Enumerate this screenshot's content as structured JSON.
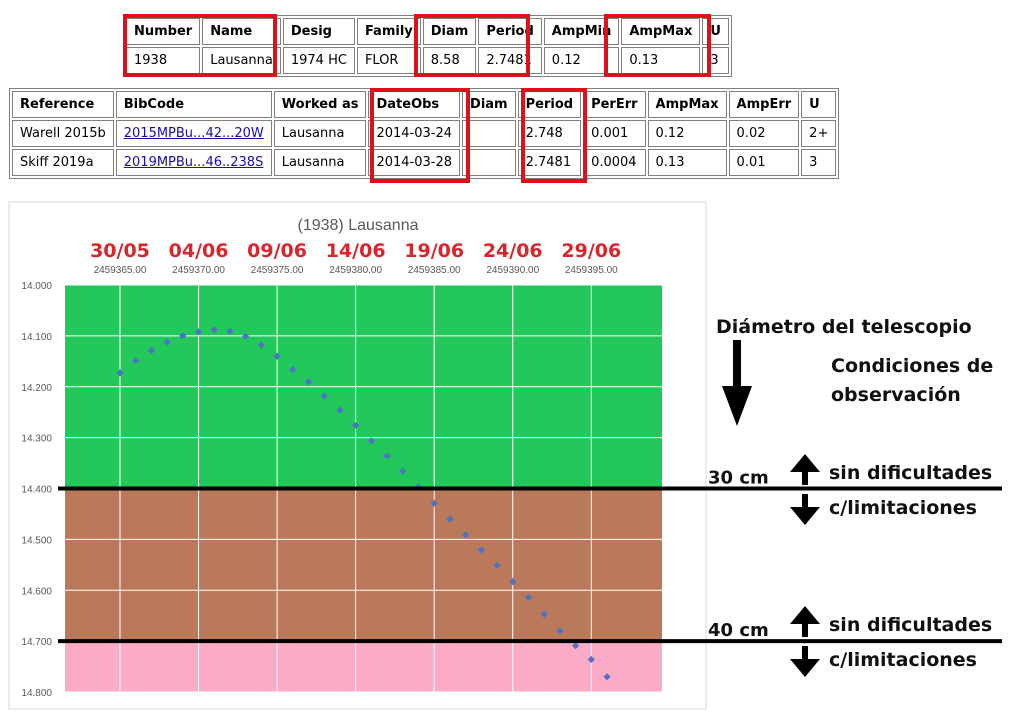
{
  "table1": {
    "headers": [
      "Number",
      "Name",
      "Desig",
      "Family",
      "Diam",
      "Period",
      "AmpMin",
      "AmpMax",
      "U"
    ],
    "row": [
      "1938",
      "Lausanna",
      "1974 HC",
      "FLOR",
      "8.58",
      "2.7481",
      "0.12",
      "0.13",
      "3"
    ]
  },
  "table2": {
    "headers": [
      "Reference",
      "BibCode",
      "Worked as",
      "DateObs",
      "Diam",
      "Period",
      "PerErr",
      "AmpMax",
      "AmpErr",
      "U"
    ],
    "rows": [
      [
        "Warell 2015b",
        "2015MPBu...42...20W",
        "Lausanna",
        "2014-03-24",
        "",
        "2.748",
        "0.001",
        "0.12",
        "0.02",
        "2+"
      ],
      [
        "Skiff 2019a",
        "2019MPBu...46..238S",
        "Lausanna",
        "2014-03-28",
        "",
        "2.7481",
        "0.0004",
        "0.13",
        "0.01",
        "3"
      ]
    ]
  },
  "colors": {
    "highlight": "#e0101a",
    "band_green": "#22c95a",
    "band_brown": "#b9795a",
    "band_pink": "#fbabc8",
    "marker": "#4d72c6",
    "date_label": "#d9262c"
  },
  "chart_data": {
    "type": "scatter",
    "title": "(1938) Lausanna",
    "x": [
      2459365.0,
      2459366.0,
      2459367.0,
      2459368.0,
      2459369.0,
      2459370.0,
      2459371.0,
      2459372.0,
      2459373.0,
      2459374.0,
      2459375.0,
      2459376.0,
      2459377.0,
      2459378.0,
      2459379.0,
      2459380.0,
      2459381.0,
      2459382.0,
      2459383.0,
      2459384.0,
      2459385.0,
      2459386.0,
      2459387.0,
      2459388.0,
      2459389.0,
      2459390.0,
      2459391.0,
      2459392.0,
      2459393.0,
      2459394.0,
      2459395.0,
      2459396.0
    ],
    "y": [
      14.173,
      14.149,
      14.129,
      14.112,
      14.1,
      14.092,
      14.088,
      14.091,
      14.101,
      14.118,
      14.14,
      14.166,
      14.19,
      14.218,
      14.246,
      14.276,
      14.306,
      14.336,
      14.366,
      14.397,
      14.429,
      14.46,
      14.491,
      14.521,
      14.551,
      14.583,
      14.614,
      14.647,
      14.68,
      14.709,
      14.736,
      14.77
    ],
    "x_ticks": [
      2459365.0,
      2459370.0,
      2459375.0,
      2459380.0,
      2459385.0,
      2459390.0,
      2459395.0
    ],
    "x_tick_labels": [
      "2459365.00",
      "2459370.00",
      "2459375.00",
      "2459380.00",
      "2459385.00",
      "2459390.00",
      "2459395.00"
    ],
    "x_date_labels": [
      "30/05",
      "04/06",
      "09/06",
      "14/06",
      "19/06",
      "24/06",
      "29/06"
    ],
    "xlim": [
      2459361.5,
      2459399.5
    ],
    "y_ticks": [
      14.0,
      14.1,
      14.2,
      14.3,
      14.4,
      14.5,
      14.6,
      14.7,
      14.8
    ],
    "y_tick_labels": [
      "14.000",
      "14.100",
      "14.200",
      "14.300",
      "14.400",
      "14.500",
      "14.600",
      "14.700",
      "14.800"
    ],
    "ylim": [
      14.8,
      14.0
    ],
    "y_inverted": true,
    "bands": [
      {
        "from": 14.0,
        "to": 14.4,
        "color": "#22c95a"
      },
      {
        "from": 14.4,
        "to": 14.7,
        "color": "#b9795a"
      },
      {
        "from": 14.7,
        "to": 14.8,
        "color": "#fbabc8"
      }
    ],
    "thresholds": [
      {
        "y": 14.4,
        "label": "30 cm"
      },
      {
        "y": 14.7,
        "label": "40 cm"
      }
    ],
    "grid": true
  },
  "annotations": {
    "telescope_label": "Diámetro del telescopio",
    "conditions_label_1": "Condiciones de",
    "conditions_label_2": "observación",
    "easy": "sin dificultades",
    "limited": "c/limitaciones"
  }
}
